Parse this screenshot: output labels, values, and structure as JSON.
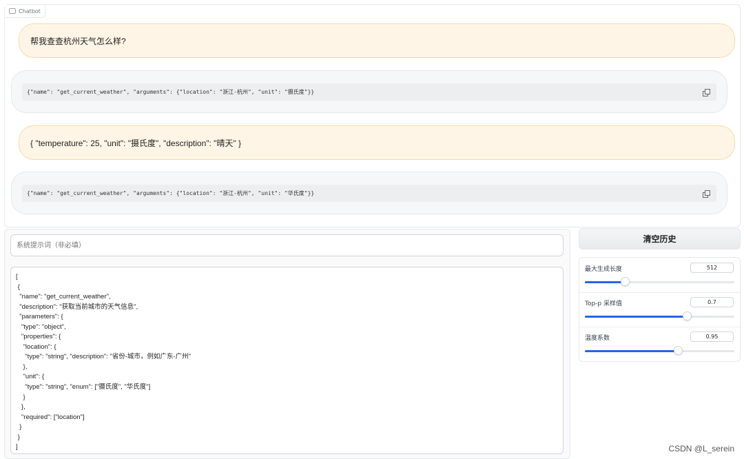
{
  "chatbot": {
    "label": "Chatbot",
    "messages": [
      {
        "role": "user",
        "text": "帮我查查杭州天气怎么样?"
      },
      {
        "role": "assistant",
        "code": "{\"name\": \"get_current_weather\", \"arguments\": {\"location\": \"浙江-杭州\", \"unit\": \"摄氏度\"}}"
      },
      {
        "role": "user",
        "text": "{ \"temperature\": 25, \"unit\": \"摄氏度\", \"description\": \"晴天\" }"
      },
      {
        "role": "assistant",
        "code": "{\"name\": \"get_current_weather\", \"arguments\": {\"location\": \"浙江-杭州\", \"unit\": \"华氏度\"}}"
      }
    ]
  },
  "system_prompt": {
    "placeholder": "系统提示词（非必填）",
    "value": ""
  },
  "tools_json": "[\n {\n  \"name\": \"get_current_weather\",\n  \"description\": \"获取当前城市的天气信息\",\n  \"parameters\": {\n   \"type\": \"object\",\n   \"properties\": {\n    \"location\": {\n     \"type\": \"string\", \"description\": \"省份-城市，例如广东-广州\"\n    },\n    \"unit\": {\n     \"type\": \"string\", \"enum\": [\"摄氏度\", \"华氏度\"]\n    }\n   },\n   \"required\": [\"location\"]\n  }\n }\n]",
  "clear_button": "清空历史",
  "params": [
    {
      "label": "最大生成长度",
      "value": "512",
      "fraction": 0.265
    },
    {
      "label": "Top-p 采样值",
      "value": "0.7",
      "fraction": 0.68
    },
    {
      "label": "温度系数",
      "value": "0.95",
      "fraction": 0.62
    }
  ],
  "watermark": "CSDN @L_serein",
  "colors": {
    "accent": "#2563eb",
    "user_bubble": "#fef5e6",
    "user_border": "#fbd9a4",
    "bot_bubble": "#f6f7f8"
  }
}
